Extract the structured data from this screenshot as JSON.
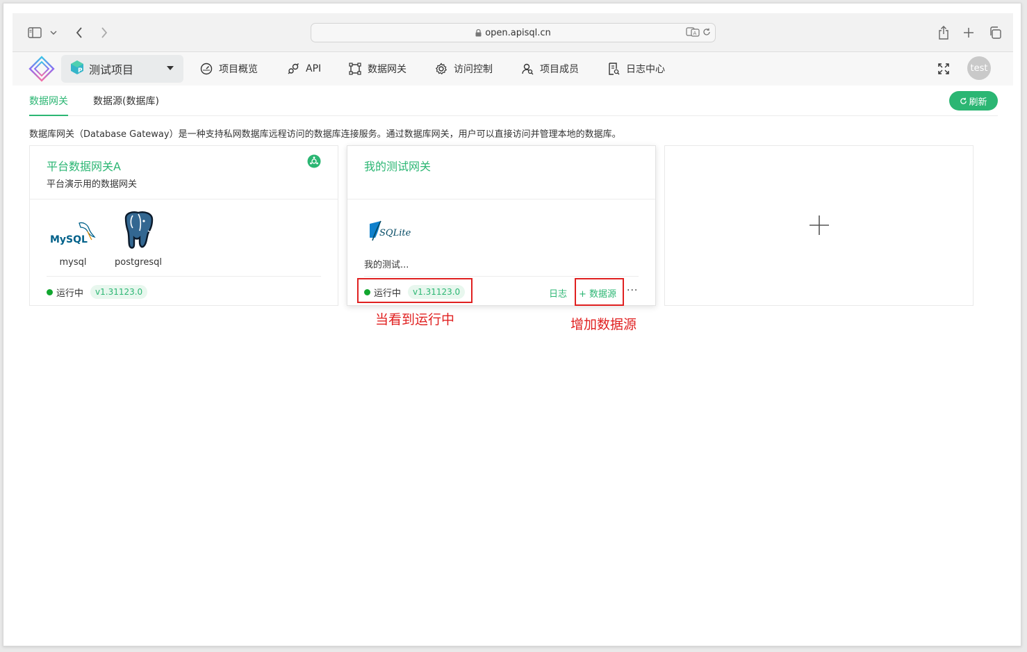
{
  "browser": {
    "url": "open.apisql.cn"
  },
  "nav": {
    "project_name": "测试项目",
    "items": [
      {
        "label": "项目概览",
        "icon": "gauge-icon"
      },
      {
        "label": "API",
        "icon": "plug-icon"
      },
      {
        "label": "数据网关",
        "icon": "gateway-icon"
      },
      {
        "label": "访问控制",
        "icon": "gear-icon"
      },
      {
        "label": "项目成员",
        "icon": "members-icon"
      },
      {
        "label": "日志中心",
        "icon": "log-icon"
      }
    ],
    "avatar_text": "test"
  },
  "tabs": [
    {
      "label": "数据网关",
      "active": true
    },
    {
      "label": "数据源(数据库)",
      "active": false
    }
  ],
  "refresh_label": "刷新",
  "description": "数据库网关（Database Gateway）是一种支持私网数据库远程访问的数据库连接服务。通过数据库网关，用户可以直接访问并管理本地的数据库。",
  "cards": [
    {
      "title": "平台数据网关A",
      "subtitle": "平台演示用的数据网关",
      "datasources": [
        {
          "name": "mysql",
          "logo_text": "MySQL"
        },
        {
          "name": "postgresql"
        }
      ],
      "status": "运行中",
      "version": "v1.31123.0"
    },
    {
      "title": "我的测试网关",
      "subtitle": "",
      "datasources": [
        {
          "name": "我的测试...",
          "logo_text": "SQLite"
        }
      ],
      "status": "运行中",
      "version": "v1.31123.0",
      "actions": {
        "log": "日志",
        "add_datasource": "+ 数据源",
        "more": "···"
      }
    }
  ],
  "annotations": {
    "running_note": "当看到运行中",
    "add_note": "增加数据源"
  },
  "colors": {
    "accent": "#2bb673",
    "status_running": "#11a62f",
    "annotation": "#e02020"
  }
}
